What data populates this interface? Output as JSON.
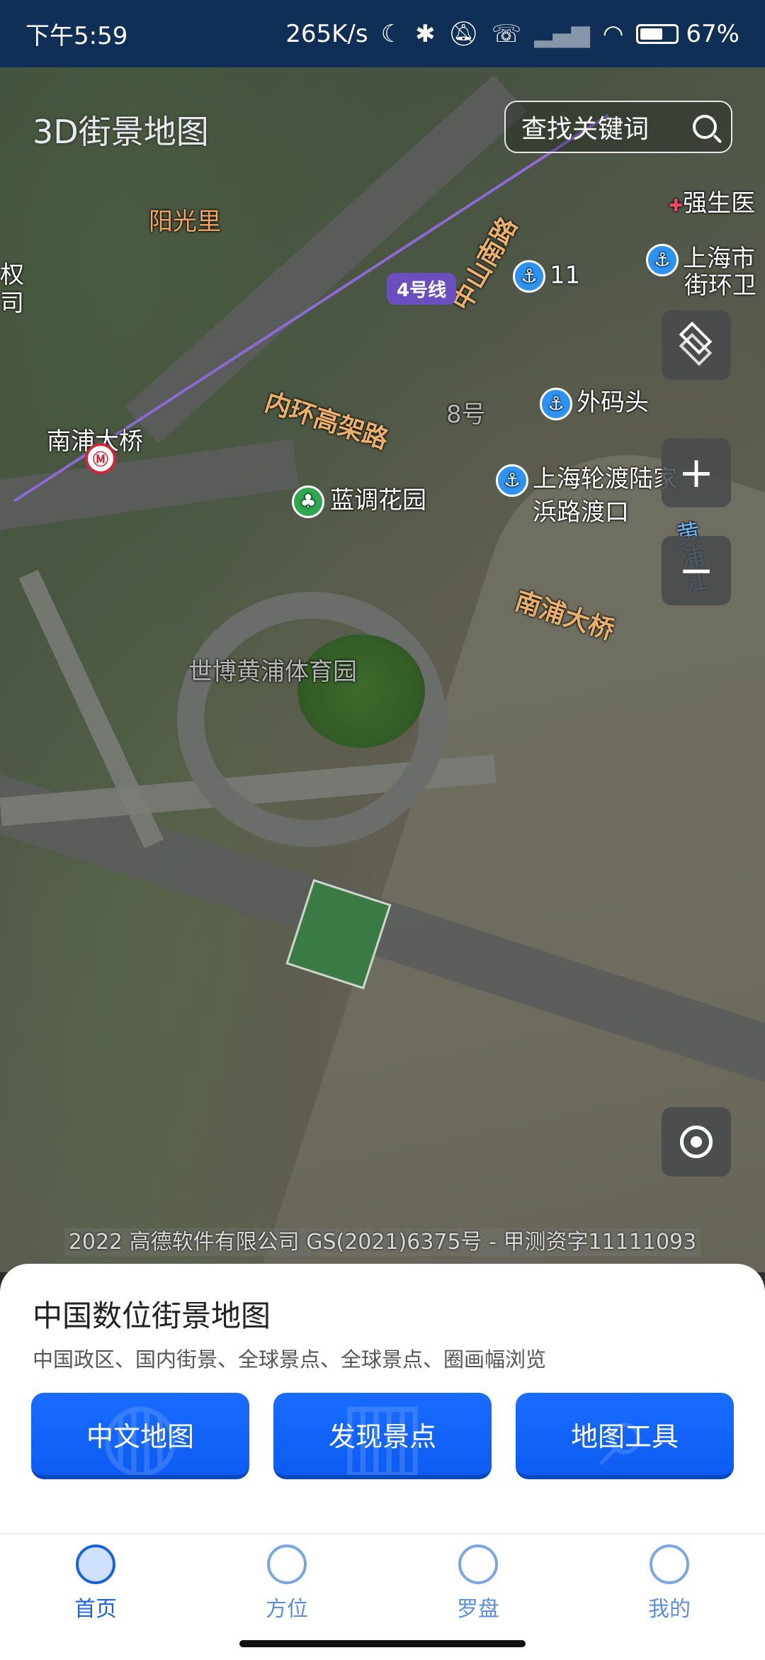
{
  "status_bar": {
    "time": "下午5:59",
    "network_speed": "265K/s",
    "battery": "67%",
    "battery_level": 0.67
  },
  "header": {
    "app_title": "3D街景地图",
    "search_placeholder": "查找关键词"
  },
  "map": {
    "labels": {
      "yangguangli": "阳光里",
      "nanpu_bridge_station": "南浦大桥",
      "zhongshan_road": "中山南路",
      "line4": "4号线",
      "inner_ring": "内环高架路",
      "lantiao_garden": "蓝调花园",
      "shibo_sports": "世博黄浦体育园",
      "nanpu_bridge": "南浦大桥",
      "huangpu_river": "黄浦江",
      "waimatou": "外码头",
      "ferry": "上海轮渡陆家",
      "ferry_line2": "浜路渡口",
      "pier11": "11",
      "pier8": "8号",
      "qiangsheng": "强生医",
      "shanghai_city_1": "上海市",
      "shanghai_city_2": "街环卫",
      "left_edge_1": "权",
      "left_edge_2": "司"
    },
    "copyright": "2022 高德软件有限公司 GS(2021)6375号 - 甲测资字11111093"
  },
  "map_controls": {
    "zoom_in": "+",
    "zoom_out": "−"
  },
  "panel": {
    "title": "中国数位街景地图",
    "subtitle": "中国政区、国内街景、全球景点、全球景点、圈画幅浏览",
    "buttons": [
      "中文地图",
      "发现景点",
      "地图工具"
    ]
  },
  "bottom_nav": {
    "items": [
      "首页",
      "方位",
      "罗盘",
      "我的"
    ],
    "active": "首页"
  },
  "colors": {
    "accent": "#1a62e0",
    "button_blue": "#1a6cff",
    "status_bar": "#0f2f57"
  }
}
